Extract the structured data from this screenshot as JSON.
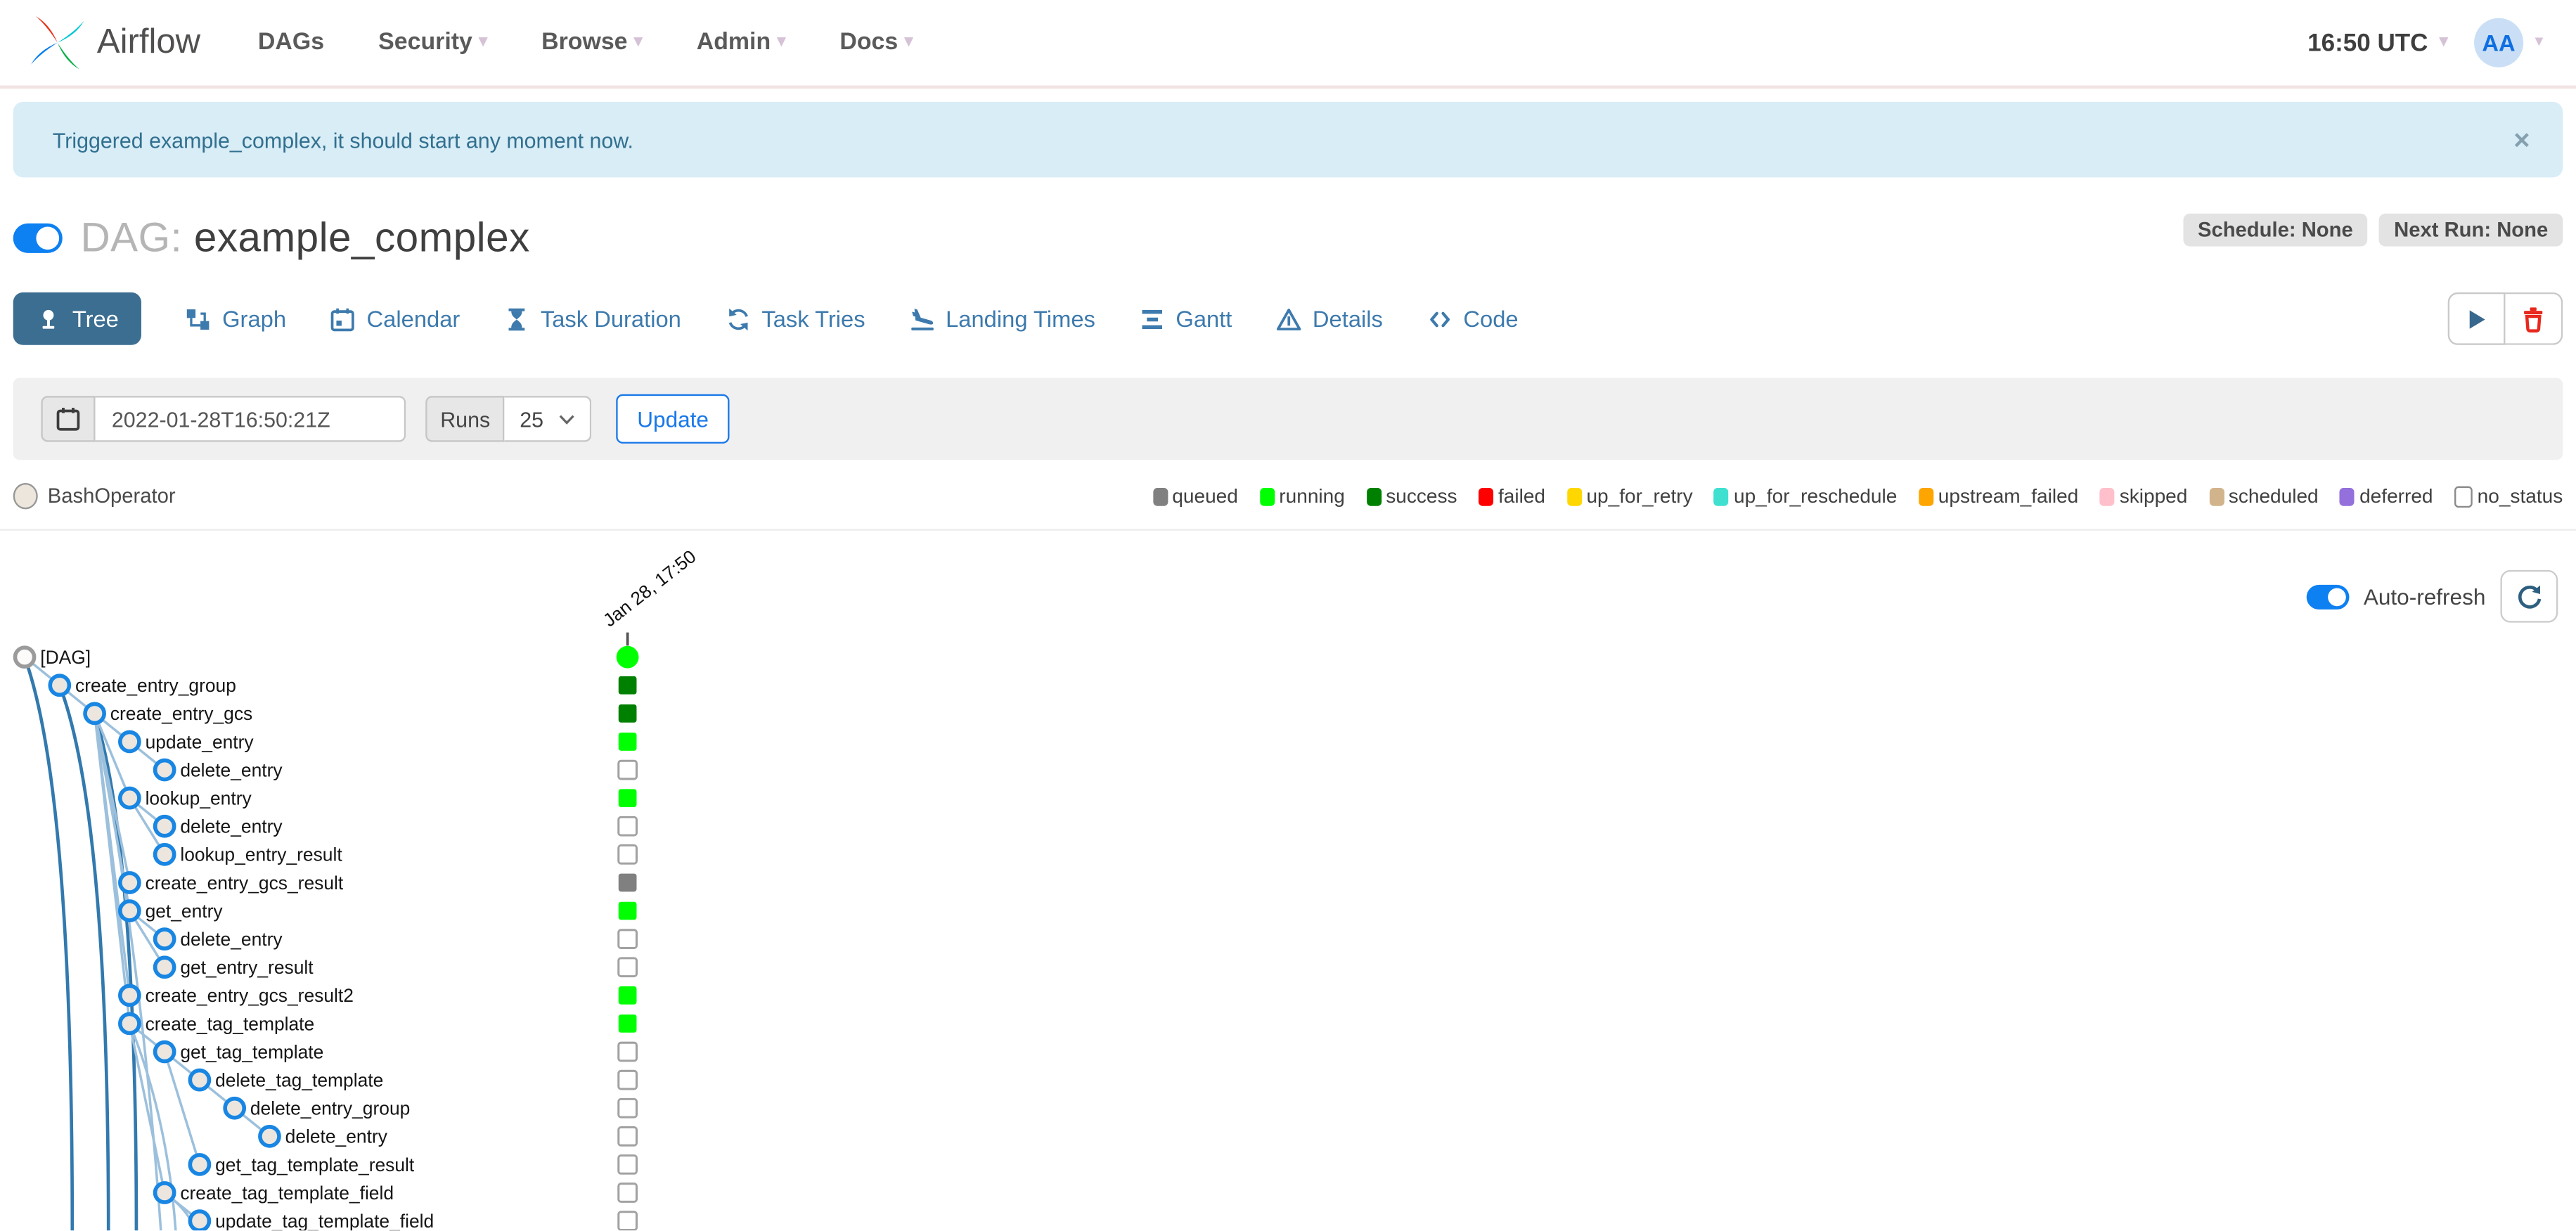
{
  "navbar": {
    "brand": "Airflow",
    "items": [
      {
        "label": "DAGs",
        "caret": false
      },
      {
        "label": "Security",
        "caret": true
      },
      {
        "label": "Browse",
        "caret": true
      },
      {
        "label": "Admin",
        "caret": true
      },
      {
        "label": "Docs",
        "caret": true
      }
    ],
    "clock": "16:50 UTC",
    "avatar": "AA"
  },
  "alert": {
    "message": "Triggered example_complex, it should start any moment now.",
    "close": "×"
  },
  "dag_header": {
    "prefix": "DAG:",
    "title": "example_complex",
    "badges": [
      "Schedule: None",
      "Next Run: None"
    ]
  },
  "tabs": [
    {
      "label": "Tree",
      "icon": "tree-icon",
      "active": true
    },
    {
      "label": "Graph",
      "icon": "graph-icon",
      "active": false
    },
    {
      "label": "Calendar",
      "icon": "calendar-icon",
      "active": false
    },
    {
      "label": "Task Duration",
      "icon": "hourglass-icon",
      "active": false
    },
    {
      "label": "Task Tries",
      "icon": "retry-icon",
      "active": false
    },
    {
      "label": "Landing Times",
      "icon": "plane-landing-icon",
      "active": false
    },
    {
      "label": "Gantt",
      "icon": "gantt-icon",
      "active": false
    },
    {
      "label": "Details",
      "icon": "details-icon",
      "active": false
    },
    {
      "label": "Code",
      "icon": "code-icon",
      "active": false
    }
  ],
  "filters": {
    "date_value": "2022-01-28T16:50:21Z",
    "runs_label": "Runs",
    "runs_value": "25",
    "update_label": "Update"
  },
  "legend": {
    "operators": [
      {
        "label": "BashOperator",
        "fill": "#ece6dd",
        "border": "#979797"
      }
    ],
    "statuses": [
      {
        "label": "queued",
        "color": "#808080"
      },
      {
        "label": "running",
        "color": "#00ff00"
      },
      {
        "label": "success",
        "color": "#008000"
      },
      {
        "label": "failed",
        "color": "#ff0000"
      },
      {
        "label": "up_for_retry",
        "color": "#ffd700"
      },
      {
        "label": "up_for_reschedule",
        "color": "#40e0d0"
      },
      {
        "label": "upstream_failed",
        "color": "#ffa500"
      },
      {
        "label": "skipped",
        "color": "#ffc0cb"
      },
      {
        "label": "scheduled",
        "color": "#d2b48c"
      },
      {
        "label": "deferred",
        "color": "#9370db"
      },
      {
        "label": "no_status",
        "color": "#ffffff",
        "border": "#8a8a8a"
      }
    ]
  },
  "autorefresh": {
    "label": "Auto-refresh"
  },
  "tree": {
    "column_label": "Jan 28, 17:50",
    "dag_run_status": "running",
    "rows": [
      {
        "name": "[DAG]",
        "level": 0,
        "status": "running"
      },
      {
        "name": "create_entry_group",
        "level": 1,
        "status": "success"
      },
      {
        "name": "create_entry_gcs",
        "level": 2,
        "status": "success"
      },
      {
        "name": "update_entry",
        "level": 3,
        "status": "running"
      },
      {
        "name": "delete_entry",
        "level": 4,
        "status": "no_status"
      },
      {
        "name": "lookup_entry",
        "level": 3,
        "status": "running"
      },
      {
        "name": "delete_entry",
        "level": 4,
        "status": "no_status"
      },
      {
        "name": "lookup_entry_result",
        "level": 4,
        "status": "no_status"
      },
      {
        "name": "create_entry_gcs_result",
        "level": 3,
        "status": "queued"
      },
      {
        "name": "get_entry",
        "level": 3,
        "status": "running"
      },
      {
        "name": "delete_entry",
        "level": 4,
        "status": "no_status"
      },
      {
        "name": "get_entry_result",
        "level": 4,
        "status": "no_status"
      },
      {
        "name": "create_entry_gcs_result2",
        "level": 3,
        "status": "running"
      },
      {
        "name": "create_tag_template",
        "level": 3,
        "status": "running"
      },
      {
        "name": "get_tag_template",
        "level": 4,
        "status": "no_status"
      },
      {
        "name": "delete_tag_template",
        "level": 5,
        "status": "no_status"
      },
      {
        "name": "delete_entry_group",
        "level": 6,
        "status": "no_status"
      },
      {
        "name": "delete_entry",
        "level": 7,
        "status": "no_status"
      },
      {
        "name": "get_tag_template_result",
        "level": 5,
        "status": "no_status"
      },
      {
        "name": "create_tag_template_field",
        "level": 4,
        "status": "no_status"
      },
      {
        "name": "update_tag_template_field",
        "level": 5,
        "status": "no_status"
      }
    ]
  },
  "colors": {
    "accent_blue": "#017cee",
    "tab_active_bg": "#3c6e91",
    "link_blue": "#3d7aad",
    "toggle_blue": "#0d80f2",
    "node_stroke": "#1886e2",
    "node_fill": "#ece6de",
    "dag_node_stroke": "#9b9b9b",
    "edge_light": "#9cc0dc",
    "edge_dark": "#3279ae",
    "alert_bg": "#d9edf7",
    "alert_text": "#31708f"
  }
}
